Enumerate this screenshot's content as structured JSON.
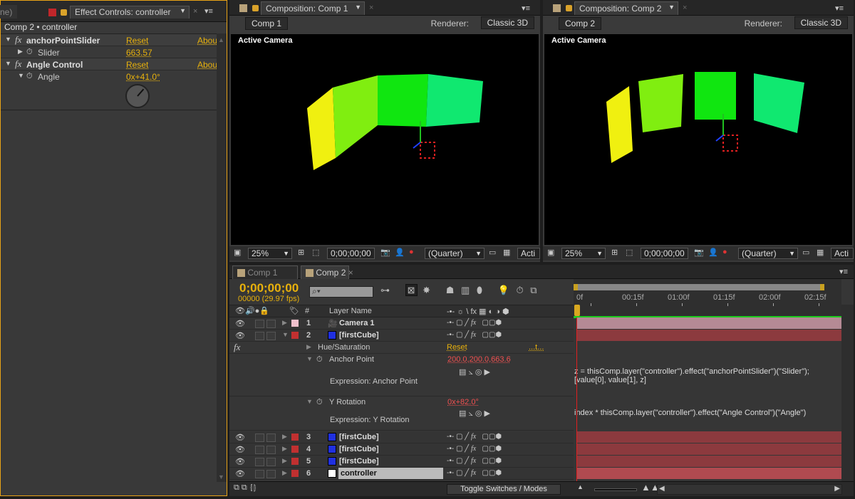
{
  "effect_controls": {
    "prev_tab_fragment": "ne)",
    "tab_title": "Effect Controls: controller",
    "breadcrumb": "Comp 2 • controller",
    "effects": [
      {
        "name": "anchorPointSlider",
        "reset": "Reset",
        "about": "Abou",
        "param": "Slider",
        "value": "663.57"
      },
      {
        "name": "Angle Control",
        "reset": "Reset",
        "about": "Abou",
        "param": "Angle",
        "value": "0x+41.0°"
      }
    ],
    "dial_angle_deg": 41,
    "accent": "#e8a317"
  },
  "viewers": [
    {
      "tab_title": "Composition: Comp 1",
      "comp_button": "Comp 1",
      "renderer_label": "Renderer:",
      "renderer": "Classic 3D",
      "camera_label": "Active Camera",
      "zoom": "25%",
      "timecode": "0;00;00;00",
      "resolution": "(Quarter)",
      "view": "Acti"
    },
    {
      "tab_title": "Composition: Comp 2",
      "comp_button": "Comp 2",
      "renderer_label": "Renderer:",
      "renderer": "Classic 3D",
      "camera_label": "Active Camera",
      "zoom": "25%",
      "timecode": "0;00;00;00",
      "resolution": "(Quarter)",
      "view": "Acti"
    }
  ],
  "timeline": {
    "tabs": [
      "Comp 1",
      "Comp 2"
    ],
    "timecode": "0;00;00;00",
    "frames": "00000 (29.97 fps)",
    "column_header": "Layer Name",
    "ruler": [
      "0f",
      "00:15f",
      "01:00f",
      "01:15f",
      "02:00f",
      "02:15f"
    ],
    "layers": [
      {
        "num": "1",
        "name": "Camera 1",
        "label_color": "#f0c0cc",
        "bar_color": "#b58a95"
      },
      {
        "num": "2",
        "name": "[firstCube]",
        "label_color": "#c03030",
        "swatch": "#2030e0",
        "bar_color": "#8c3a3e"
      }
    ],
    "properties": {
      "effect": "Hue/Saturation",
      "effect_reset": "Reset",
      "effect_about": "...t...",
      "anchor_label": "Anchor Point",
      "anchor_value": "200.0,200.0,663.6",
      "anchor_expr_label": "Expression: Anchor Point",
      "anchor_expr": [
        "z = thisComp.layer(\"controller\").effect(\"anchorPointSlider\")(\"Slider\");",
        "[value[0], value[1], z]"
      ],
      "yrot_label": "Y Rotation",
      "yrot_value": "0x+82.0°",
      "yrot_expr_label": "Expression: Y Rotation",
      "yrot_expr": "index * thisComp.layer(\"controller\").effect(\"Angle Control\")(\"Angle\")"
    },
    "more_layers": [
      {
        "num": "3",
        "name": "[firstCube]",
        "swatch": "#2030e0"
      },
      {
        "num": "4",
        "name": "[firstCube]",
        "swatch": "#2030e0"
      },
      {
        "num": "5",
        "name": "[firstCube]",
        "swatch": "#2030e0"
      },
      {
        "num": "6",
        "name": "controller",
        "swatch": "#ffffff"
      }
    ],
    "toggle": "Toggle Switches / Modes"
  }
}
